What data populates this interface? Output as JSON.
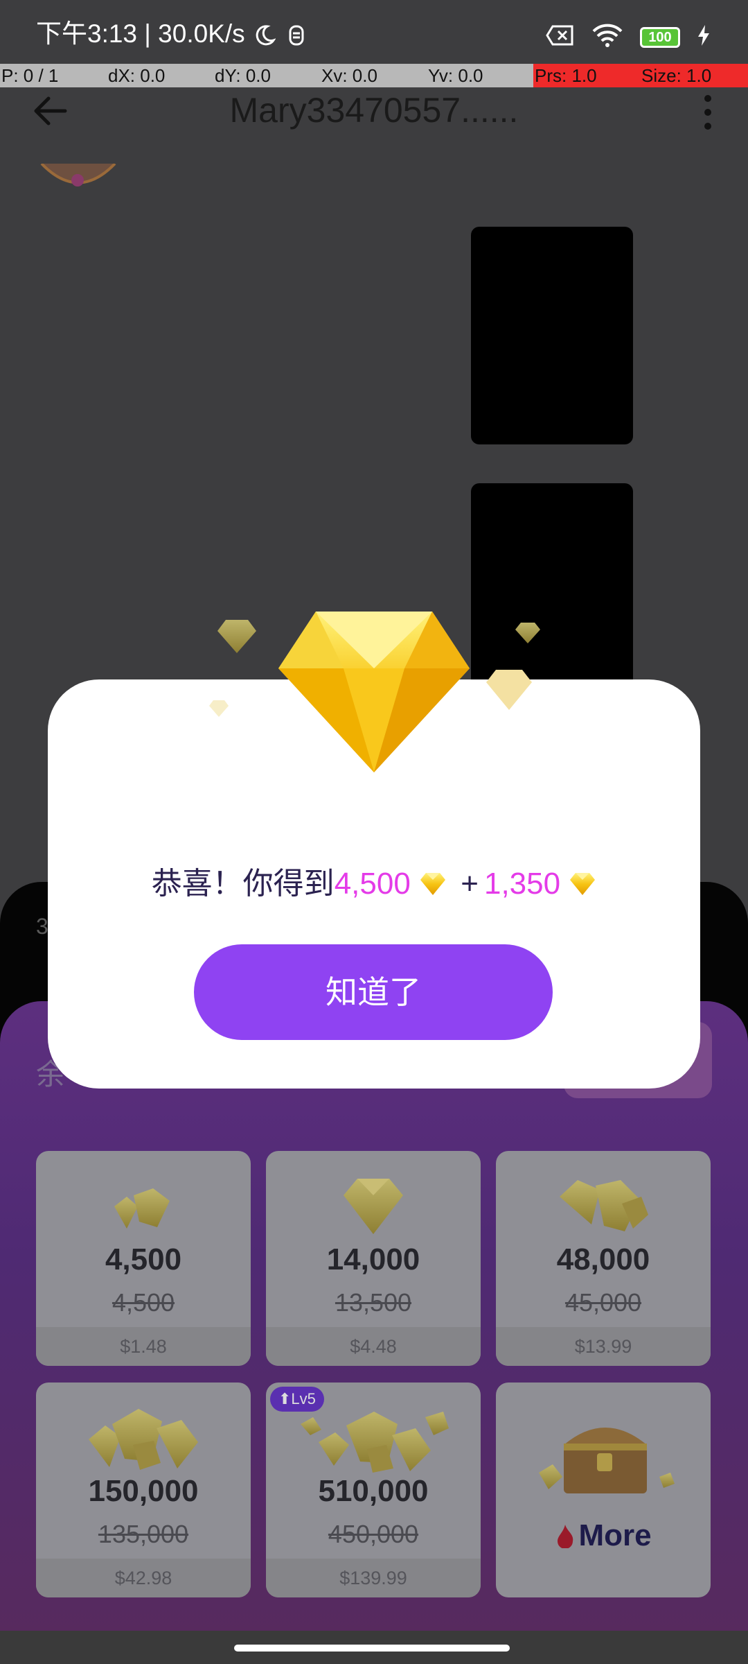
{
  "status_bar": {
    "time_speed": "下午3:13 | 30.0K/s",
    "battery": "100"
  },
  "pointer_overlay": {
    "fields": [
      "P: 0 / 1",
      "dX: 0.0",
      "dY: 0.0",
      "Xv: 0.0",
      "Yv: 0.0",
      "Prs: 1.0",
      "Size: 1.0"
    ]
  },
  "header": {
    "title": "Mary33470557......"
  },
  "sheet": {
    "left_label_partial": "余",
    "peek_text": "3",
    "tiles": [
      {
        "amount": "4,500",
        "original": "4,500",
        "price": "$1.48"
      },
      {
        "amount": "14,000",
        "original": "13,500",
        "price": "$4.48"
      },
      {
        "amount": "48,000",
        "original": "45,000",
        "price": "$13.99"
      },
      {
        "amount": "150,000",
        "original": "135,000",
        "price": "$42.98"
      },
      {
        "amount": "510,000",
        "original": "450,000",
        "price": "$139.99",
        "badge": "⬆Lv5"
      },
      {
        "label": "More"
      }
    ]
  },
  "dialog": {
    "prefix": "恭喜！你得到",
    "amount1": "4,500",
    "plus": "+",
    "amount2": "1,350",
    "button_label": "知道了"
  },
  "colors": {
    "accent_purple": "#8f43f2",
    "highlight_pink": "#e43be8",
    "overlay_red": "#ee2a2a",
    "gem_gold": "#f5c518"
  },
  "icons": [
    "back-arrow-icon",
    "more-vert-icon",
    "moon-icon",
    "notification-icon",
    "sim-x-icon",
    "wifi-icon",
    "battery-icon",
    "charging-icon",
    "diamond-icon",
    "treasure-chest-icon"
  ]
}
